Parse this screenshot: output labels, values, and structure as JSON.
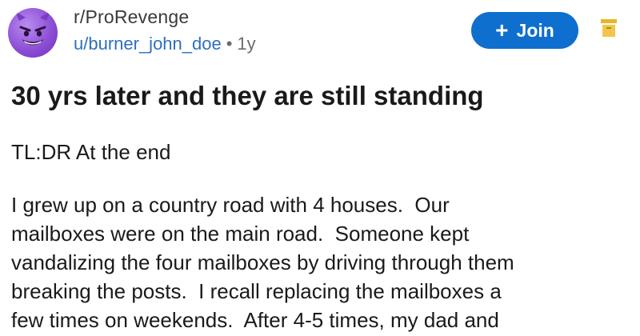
{
  "header": {
    "subreddit": "r/ProRevenge",
    "username": "u/burner_john_doe",
    "separator": "•",
    "age": "1y",
    "avatar_icon": "devil-face-icon",
    "join_label": "Join",
    "join_icon": "plus-icon",
    "archive_icon": "archive-box-icon"
  },
  "post": {
    "title": "30 yrs later and they are still standing",
    "tldr": "TL:DR At the end",
    "body_lines": [
      "I grew up on a country road with 4 houses.  Our",
      "mailboxes were on the main road.  Someone kept",
      "vandalizing the four mailboxes by driving through them",
      "breaking the posts.  I recall replacing the mailboxes a",
      "few times on weekends.  After 4-5 times, my dad and"
    ]
  },
  "colors": {
    "join_button": "#0e6fcf",
    "username": "#2f6fbf",
    "avatar": "#8e4fd6",
    "archive_icon": "#e8b62c"
  }
}
